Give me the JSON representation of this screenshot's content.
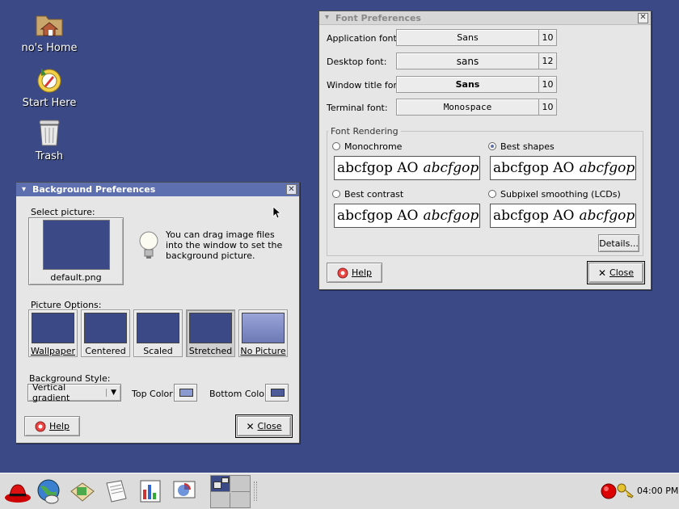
{
  "desktop": {
    "icons": [
      {
        "label": "no's Home",
        "icon": "home-folder-icon"
      },
      {
        "label": "Start Here",
        "icon": "start-here-icon"
      },
      {
        "label": "Trash",
        "icon": "trash-icon"
      }
    ]
  },
  "font_prefs": {
    "title": "Font Preferences",
    "rows": [
      {
        "label": "Application font:",
        "font": "Sans",
        "size": "10"
      },
      {
        "label": "Desktop font:",
        "font": "sans",
        "size": "12"
      },
      {
        "label": "Window title font:",
        "font": "Sans",
        "size": "10"
      },
      {
        "label": "Terminal font:",
        "font": "Monospace",
        "size": "10"
      }
    ],
    "rendering": {
      "title": "Font Rendering",
      "options": [
        {
          "label": "Monochrome",
          "selected": false
        },
        {
          "label": "Best shapes",
          "selected": true
        },
        {
          "label": "Best contrast",
          "selected": false
        },
        {
          "label": "Subpixel smoothing (LCDs)",
          "selected": false
        }
      ],
      "sample_plain": "abcfgop AO",
      "sample_italic": "abcfgop"
    },
    "details_label": "Details...",
    "help_label": "Help",
    "close_label": "Close"
  },
  "bg_prefs": {
    "title": "Background Preferences",
    "select_picture_label": "Select picture:",
    "picture_name": "default.png",
    "hint": "You can drag image files into the window to set the background picture.",
    "picture_options_label": "Picture Options:",
    "options": [
      {
        "label": "Wallpaper",
        "selected": false
      },
      {
        "label": "Centered",
        "selected": false
      },
      {
        "label": "Scaled",
        "selected": false
      },
      {
        "label": "Stretched",
        "selected": true
      },
      {
        "label": "No Picture",
        "selected": false
      }
    ],
    "style_label": "Background Style:",
    "style_value": "Vertical gradient",
    "top_color_label": "Top Color:",
    "bottom_color_label": "Bottom Color:",
    "help_label": "Help",
    "close_label": "Close"
  },
  "colors": {
    "desktop": "#3b4a86",
    "active_title": "#5d6fae",
    "top_color": "#8c9ad2",
    "bottom_color": "#4d5c98"
  },
  "panel": {
    "launchers": [
      "redhat-menu-icon",
      "web-browser-icon",
      "email-icon",
      "writer-icon",
      "spreadsheet-icon",
      "presentation-icon"
    ],
    "clock": "04:00 PM"
  }
}
